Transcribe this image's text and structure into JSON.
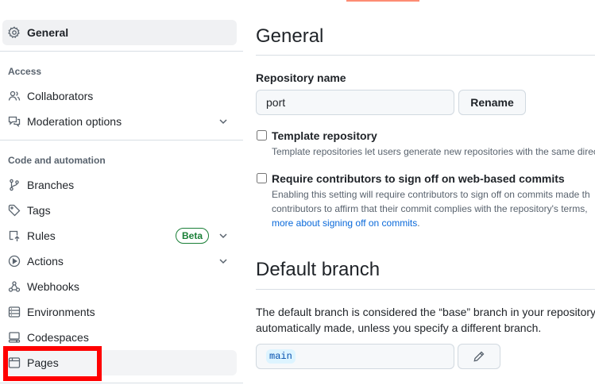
{
  "sidebar": {
    "general_label": "General",
    "access_heading": "Access",
    "access_items": [
      {
        "label": "Collaborators"
      },
      {
        "label": "Moderation options"
      }
    ],
    "code_heading": "Code and automation",
    "code_items": [
      {
        "label": "Branches"
      },
      {
        "label": "Tags"
      },
      {
        "label": "Rules",
        "badge": "Beta"
      },
      {
        "label": "Actions"
      },
      {
        "label": "Webhooks"
      },
      {
        "label": "Environments"
      },
      {
        "label": "Codespaces"
      },
      {
        "label": "Pages"
      }
    ]
  },
  "main": {
    "general_title": "General",
    "repo_name_label": "Repository name",
    "repo_name_value": "port",
    "rename_label": "Rename",
    "template": {
      "title": "Template repository",
      "description": "Template repositories let users generate new repositories with the same direc"
    },
    "signoff": {
      "title": "Require contributors to sign off on web-based commits",
      "desc_line1": "Enabling this setting will require contributors to sign off on commits made th",
      "desc_line2": "contributors to affirm that their commit complies with the repository's terms,",
      "desc_link": "more about signing off on commits",
      "desc_end": "."
    },
    "default_branch_title": "Default branch",
    "default_branch_line1": "The default branch is considered the “base” branch in your repository",
    "default_branch_line2": "automatically made, unless you specify a different branch.",
    "branch_value": "main"
  },
  "colors": {
    "accent_link": "#0969da",
    "success_badge": "#1a7f37",
    "annotation_red": "#ff0000"
  }
}
